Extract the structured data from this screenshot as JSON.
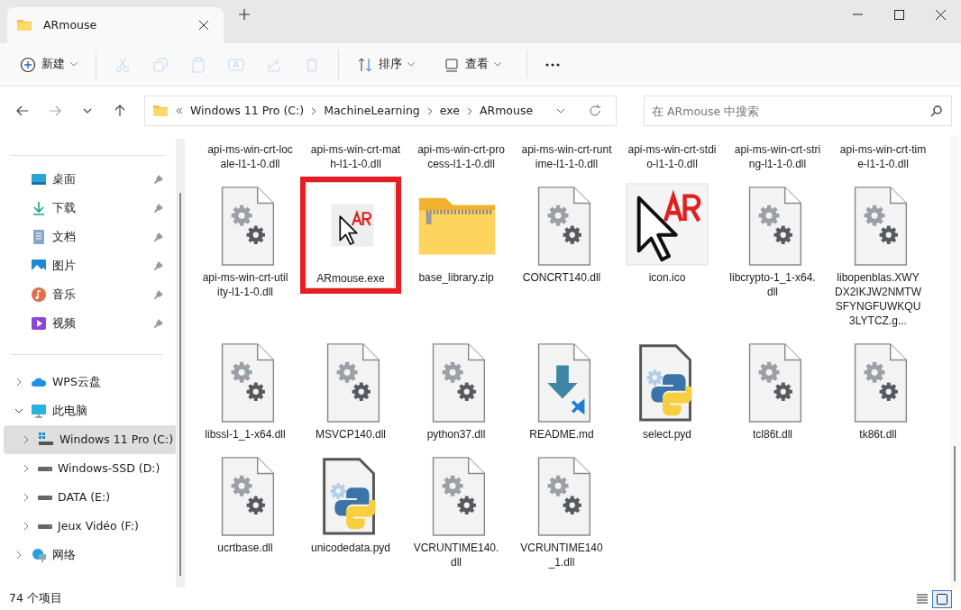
{
  "window": {
    "tab_title": "ARmouse"
  },
  "toolbar": [
    {
      "kind": "new",
      "label": "新建",
      "disabled": false
    },
    {
      "kind": "cut",
      "disabled": true
    },
    {
      "kind": "copy",
      "disabled": true
    },
    {
      "kind": "paste",
      "disabled": true
    },
    {
      "kind": "rename",
      "disabled": true
    },
    {
      "kind": "share",
      "disabled": true
    },
    {
      "kind": "delete",
      "disabled": true
    },
    {
      "kind": "sort",
      "label": "排序",
      "disabled": false
    },
    {
      "kind": "view",
      "label": "查看",
      "disabled": false
    },
    {
      "kind": "more",
      "disabled": false
    }
  ],
  "address": {
    "path": [
      "Windows 11 Pro (C:)",
      "MachineLearning",
      "exe",
      "ARmouse"
    ],
    "search_placeholder": "在 ARmouse 中搜索"
  },
  "sidebar": {
    "quick_access": [
      {
        "kind": "desktop",
        "label": "桌面",
        "pinned": true
      },
      {
        "kind": "downloads",
        "label": "下载",
        "pinned": true
      },
      {
        "kind": "documents",
        "label": "文档",
        "pinned": true
      },
      {
        "kind": "pictures",
        "label": "图片",
        "pinned": true
      },
      {
        "kind": "music",
        "label": "音乐",
        "pinned": true
      },
      {
        "kind": "videos",
        "label": "视频",
        "pinned": true
      }
    ],
    "tree": [
      {
        "kind": "cloud",
        "label": "WPS云盘",
        "expanded": false,
        "selected": false
      },
      {
        "kind": "pc",
        "label": "此电脑",
        "expanded": true,
        "selected": false,
        "children": [
          {
            "kind": "system-drive",
            "label": "Windows 11 Pro (C:)",
            "expanded": false,
            "selected": true
          },
          {
            "kind": "drive",
            "label": "Windows-SSD (D:)",
            "expanded": false,
            "selected": false
          },
          {
            "kind": "drive",
            "label": "DATA (E:)",
            "expanded": false,
            "selected": false
          },
          {
            "kind": "drive",
            "label": "Jeux Vidéo (F:)",
            "expanded": false,
            "selected": false
          }
        ]
      },
      {
        "kind": "network",
        "label": "网络",
        "expanded": false,
        "selected": false
      }
    ]
  },
  "partly_scrolled_files": [
    {
      "name": "api-ms-win-crt-locale-l1-1-0.dll"
    },
    {
      "name": "api-ms-win-crt-math-l1-1-0.dll"
    },
    {
      "name": "api-ms-win-crt-process-l1-1-0.dll"
    },
    {
      "name": "api-ms-win-crt-runtime-l1-1-0.dll"
    },
    {
      "name": "api-ms-win-crt-stdio-l1-1-0.dll"
    },
    {
      "name": "api-ms-win-crt-string-l1-1-0.dll"
    },
    {
      "name": "api-ms-win-crt-time-l1-1-0.dll"
    }
  ],
  "files": [
    {
      "name": "api-ms-win-crt-utility-l1-1-0.dll",
      "kind": "dll",
      "selected": false,
      "marked": false
    },
    {
      "name": "ARmouse.exe",
      "kind": "exe",
      "selected": true,
      "marked": true
    },
    {
      "name": "base_library.zip",
      "kind": "zip",
      "selected": false,
      "marked": false
    },
    {
      "name": "CONCRT140.dll",
      "kind": "dll",
      "selected": false,
      "marked": false
    },
    {
      "name": "icon.ico",
      "kind": "ico",
      "selected": false,
      "marked": false
    },
    {
      "name": "libcrypto-1_1-x64.dll",
      "kind": "dll",
      "selected": false,
      "marked": false
    },
    {
      "name": "libopenblas.XWYDX2IKJW2NMTWSFYNGFUWKQU3LYTCZ.g...",
      "kind": "dll",
      "selected": false,
      "marked": false
    },
    {
      "name": "libssl-1_1-x64.dll",
      "kind": "dll",
      "selected": false,
      "marked": false
    },
    {
      "name": "MSVCP140.dll",
      "kind": "dll",
      "selected": false,
      "marked": false
    },
    {
      "name": "python37.dll",
      "kind": "dll",
      "selected": false,
      "marked": false
    },
    {
      "name": "README.md",
      "kind": "md",
      "selected": false,
      "marked": false
    },
    {
      "name": "select.pyd",
      "kind": "pyd",
      "selected": false,
      "marked": false
    },
    {
      "name": "tcl86t.dll",
      "kind": "dll",
      "selected": false,
      "marked": false
    },
    {
      "name": "tk86t.dll",
      "kind": "dll",
      "selected": false,
      "marked": false
    },
    {
      "name": "ucrtbase.dll",
      "kind": "dll",
      "selected": false,
      "marked": false
    },
    {
      "name": "unicodedata.pyd",
      "kind": "pyd",
      "selected": false,
      "marked": false
    },
    {
      "name": "VCRUNTIME140.dll",
      "kind": "dll",
      "selected": false,
      "marked": false
    },
    {
      "name": "VCRUNTIME140_1.dll",
      "kind": "dll",
      "selected": false,
      "marked": false
    }
  ],
  "status_bar": {
    "item_count": "74 个项目",
    "views": [
      {
        "kind": "details",
        "selected": false
      },
      {
        "kind": "large-icons",
        "selected": true
      }
    ]
  }
}
